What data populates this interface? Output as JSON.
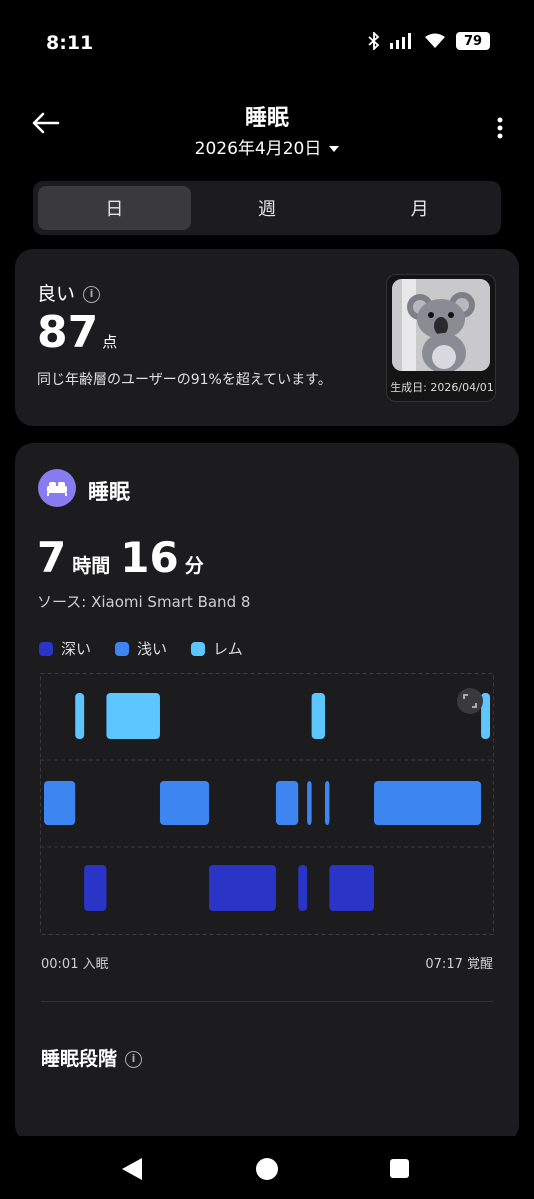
{
  "status": {
    "time": "8:11",
    "battery": "79"
  },
  "header": {
    "title": "睡眠",
    "date": "2026年4月20日"
  },
  "tabs": [
    "日",
    "週",
    "月"
  ],
  "score_card": {
    "rating": "良い",
    "score": "87",
    "unit": "点",
    "comparison": "同じ年齢層のユーザーの91%を超えています。",
    "image_caption": "生成日: 2026/04/01"
  },
  "sleep": {
    "title": "睡眠",
    "hours": "7",
    "hours_unit": "時間",
    "minutes": "16",
    "minutes_unit": "分",
    "source": "ソース: Xiaomi Smart Band 8",
    "legend": [
      "深い",
      "浅い",
      "レム"
    ],
    "start_label": "00:01 入眠",
    "end_label": "07:17 覚醒",
    "stages_title": "睡眠段階"
  },
  "colors": {
    "deep": "#2a35c8",
    "light": "#3d86f2",
    "rem": "#5ec6ff",
    "icon": "#8a7cf0"
  },
  "chart_data": {
    "type": "sleep-stages",
    "start": "00:01",
    "end": "07:17",
    "segments": [
      {
        "stage": "light",
        "from": 0.0,
        "to": 0.07
      },
      {
        "stage": "rem",
        "from": 0.07,
        "to": 0.09
      },
      {
        "stage": "deep",
        "from": 0.09,
        "to": 0.14
      },
      {
        "stage": "rem",
        "from": 0.14,
        "to": 0.26
      },
      {
        "stage": "light",
        "from": 0.26,
        "to": 0.37
      },
      {
        "stage": "deep",
        "from": 0.37,
        "to": 0.52
      },
      {
        "stage": "light",
        "from": 0.52,
        "to": 0.57
      },
      {
        "stage": "deep",
        "from": 0.57,
        "to": 0.59
      },
      {
        "stage": "light",
        "from": 0.59,
        "to": 0.6
      },
      {
        "stage": "rem",
        "from": 0.6,
        "to": 0.63
      },
      {
        "stage": "light",
        "from": 0.63,
        "to": 0.64
      },
      {
        "stage": "deep",
        "from": 0.64,
        "to": 0.74
      },
      {
        "stage": "light",
        "from": 0.74,
        "to": 0.98
      },
      {
        "stage": "rem",
        "from": 0.98,
        "to": 1.0
      }
    ]
  }
}
